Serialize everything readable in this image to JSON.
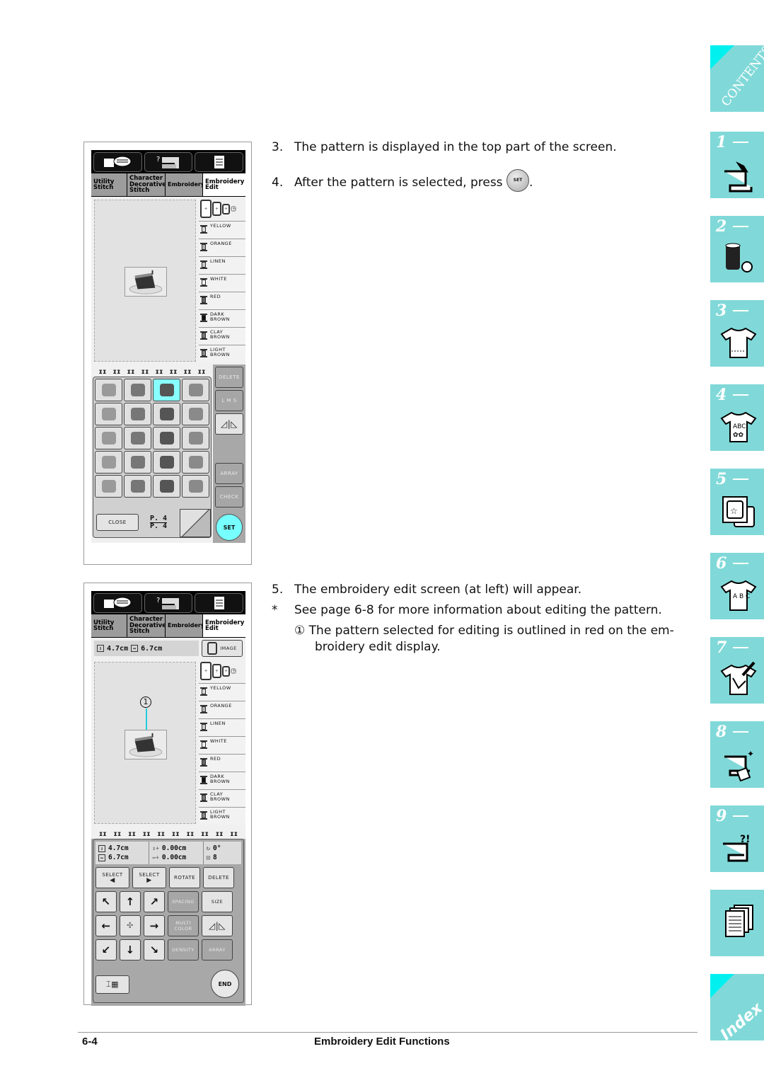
{
  "screen_common": {
    "top_icons": [
      "manual-book-icon",
      "help-machine-icon",
      "settings-list-icon"
    ],
    "tabs": [
      {
        "label": "Utility Stitch",
        "lines": [
          "Utility",
          "Stitch"
        ]
      },
      {
        "label": "Character Decorative Stitch",
        "lines": [
          "Character",
          "Decorative",
          "Stitch"
        ]
      },
      {
        "label": "Embroidery",
        "lines": [
          "Embroidery"
        ]
      },
      {
        "label": "Embroidery Edit",
        "lines": [
          "Embroidery",
          "Edit"
        ],
        "active": true
      }
    ],
    "threads": [
      {
        "name": [
          "YELLOW"
        ],
        "color": "#d8d8d8"
      },
      {
        "name": [
          "ORANGE"
        ],
        "color": "#b0b0b0"
      },
      {
        "name": [
          "LINEN"
        ],
        "color": "#cccccc"
      },
      {
        "name": [
          "WHITE"
        ],
        "color": "#f2f2f2"
      },
      {
        "name": [
          "RED"
        ],
        "color": "#666666"
      },
      {
        "name": [
          "DARK",
          "BROWN"
        ],
        "color": "#111111"
      },
      {
        "name": [
          "CLAY",
          "BROWN"
        ],
        "color": "#777777"
      },
      {
        "name": [
          "LIGHT",
          "BROWN"
        ],
        "color": "#888888"
      }
    ]
  },
  "screen1": {
    "side_buttons": {
      "delete": "DELETE",
      "lms": "L M S",
      "mirror": "mirror-icon",
      "array": "ARRAY",
      "check": "CHECK"
    },
    "selected_cell_index": 2,
    "close_label": "CLOSE",
    "page_current": "P. 4",
    "page_total": "P. 4",
    "set_label": "SET"
  },
  "screen2": {
    "height_value": "4.7cm",
    "width_value": "6.7cm",
    "image_label": "IMAGE",
    "readout": {
      "height": "4.7cm",
      "width": "6.7cm",
      "v_offset": "0.00cm",
      "h_offset": "0.00cm",
      "rotation": "0°",
      "colors": "8"
    },
    "buttons": {
      "select_prev": "SELECT",
      "select_next": "SELECT",
      "rotate": "ROTATE",
      "delete": "DELETE",
      "spacing": "SPACING",
      "size": "SIZE",
      "multi_color": "MULTI COLOR",
      "density": "DENSITY",
      "array": "ARRAY",
      "end": "END"
    },
    "callout": "1"
  },
  "instructions": {
    "step3": {
      "num": "3.",
      "text": "The pattern is displayed in the top part of the screen."
    },
    "step4": {
      "num": "4.",
      "text": "After the pattern is selected, press",
      "button": "SET",
      "after": "."
    },
    "step5": {
      "num": "5.",
      "text": "The embroidery edit screen (at left) will appear."
    },
    "note": {
      "num": "*",
      "text": "See page 6-8 for more information about editing the pattern."
    },
    "callout_note": {
      "num": "①",
      "line1": "The pattern selected for editing is outlined in red on the em-",
      "line2": "broidery edit display."
    }
  },
  "footer": {
    "page": "6-4",
    "title": "Embroidery Edit Functions"
  },
  "side_tabs": [
    {
      "label": "CONTENTS",
      "icon": "contents"
    },
    {
      "label": "1 —",
      "icon": "sewing-machine-hand-icon"
    },
    {
      "label": "2 —",
      "icon": "thread-spool-icon"
    },
    {
      "label": "3 —",
      "icon": "shirt-icon"
    },
    {
      "label": "4 —",
      "icon": "shirt-abc-icon"
    },
    {
      "label": "5 —",
      "icon": "embroidery-frame-icon"
    },
    {
      "label": "6 —",
      "icon": "shirt-letters-icon"
    },
    {
      "label": "7 —",
      "icon": "shirt-pencil-icon"
    },
    {
      "label": "8 —",
      "icon": "machine-sparkle-icon"
    },
    {
      "label": "9 —",
      "icon": "machine-question-icon"
    },
    {
      "label": "",
      "icon": "pages-icon"
    },
    {
      "label": "Index",
      "icon": "index"
    }
  ]
}
